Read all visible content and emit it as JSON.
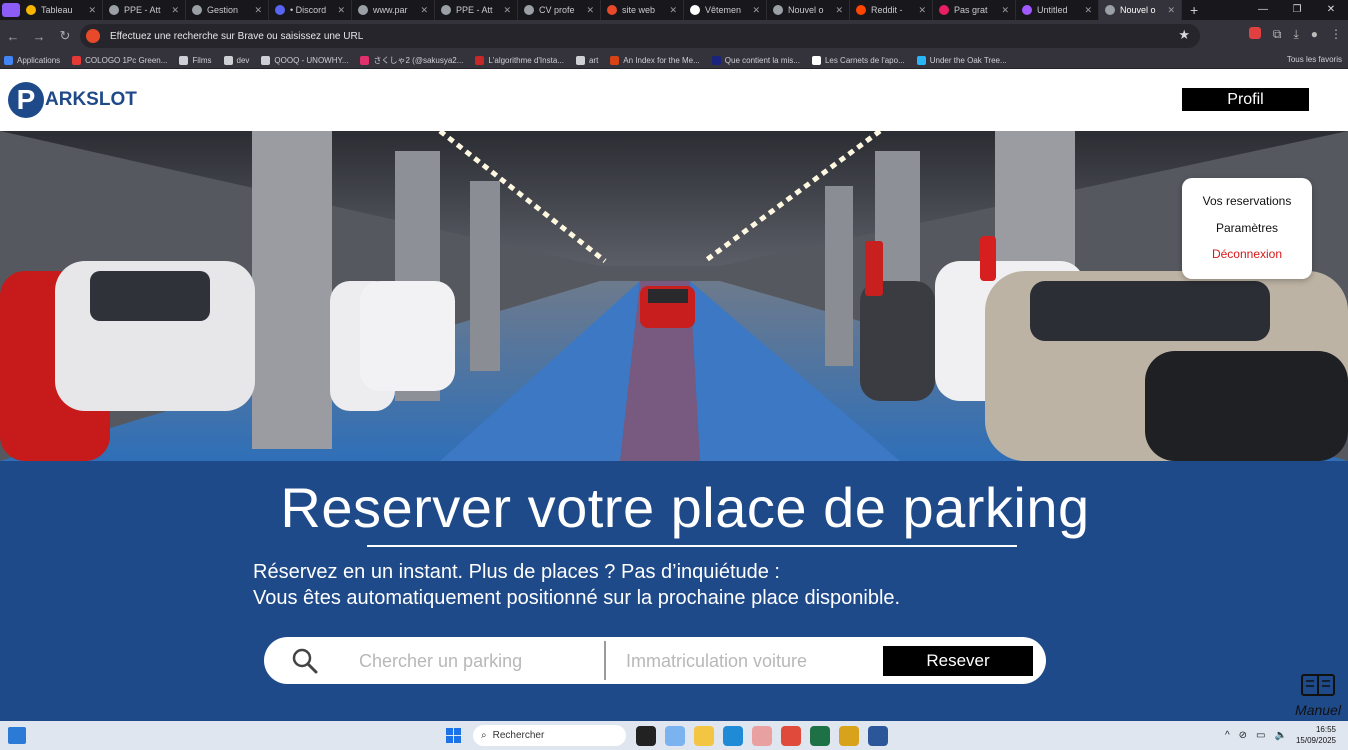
{
  "browser": {
    "tabs": [
      {
        "title": "Tableau",
        "icon": "miro-icon",
        "color": "#f7b500"
      },
      {
        "title": "PPE - Att",
        "icon": "globe-icon",
        "color": "#9aa0a6"
      },
      {
        "title": "Gestion",
        "icon": "gear-icon",
        "color": "#9aa0a6"
      },
      {
        "title": "• Discord",
        "icon": "discord-icon",
        "color": "#5865f2"
      },
      {
        "title": "www.par",
        "icon": "globe-icon",
        "color": "#9aa0a6"
      },
      {
        "title": "PPE - Att",
        "icon": "globe-icon",
        "color": "#9aa0a6"
      },
      {
        "title": "CV profe",
        "icon": "file-icon",
        "color": "#9aa0a6"
      },
      {
        "title": "site web",
        "icon": "brave-icon",
        "color": "#e8492a"
      },
      {
        "title": "Vêtemen",
        "icon": "b-icon",
        "color": "#ffffff"
      },
      {
        "title": "Nouvel o",
        "icon": "globe-icon",
        "color": "#9aa0a6"
      },
      {
        "title": "Reddit -",
        "icon": "reddit-icon",
        "color": "#ff4500"
      },
      {
        "title": "Pas grat",
        "icon": "shop-icon",
        "color": "#e91e63"
      },
      {
        "title": "Untitled",
        "icon": "figma-icon",
        "color": "#a259ff"
      },
      {
        "title": "Nouvel o",
        "icon": "globe-icon",
        "color": "#9aa0a6",
        "active": true
      }
    ],
    "new_tab": "+",
    "address_placeholder": "Effectuez une recherche sur Brave ou saisissez une URL",
    "bookmarks": [
      {
        "label": "Applications",
        "color": "#4285f4"
      },
      {
        "label": "COLOGO 1Pc Green...",
        "color": "#e53935"
      },
      {
        "label": "Films",
        "color": "#cfcfd6"
      },
      {
        "label": "dev",
        "color": "#cfcfd6"
      },
      {
        "label": "QOOQ - UNOWHY...",
        "color": "#cfcfd6"
      },
      {
        "label": "さくしゃ2 (@sakusya2...",
        "color": "#e1306c"
      },
      {
        "label": "L'algorithme d'Insta...",
        "color": "#c62828"
      },
      {
        "label": "art",
        "color": "#cfcfd6"
      },
      {
        "label": "An Index for the Me...",
        "color": "#d84315"
      },
      {
        "label": "Que contient la mis...",
        "color": "#1a237e"
      },
      {
        "label": "Les Carnets de l'apo...",
        "color": "#ffffff"
      },
      {
        "label": "Under the Oak Tree...",
        "color": "#29b6f6"
      }
    ],
    "bookmarks_right": "Tous les favoris"
  },
  "site": {
    "logo_letter": "P",
    "logo_text": "ARKSLOT",
    "profil_label": "Profil",
    "menu": {
      "reservations": "Vos reservations",
      "settings": "Paramètres",
      "logout": "Déconnexion"
    },
    "headline": "Reserver votre place de parking",
    "subtitle_line1": "Réservez en un instant. Plus de places ? Pas d’inquiétude :",
    "subtitle_line2": "Vous êtes automatiquement positionné sur la prochaine place disponible.",
    "search_parking_placeholder": "Chercher un parking",
    "plate_placeholder": "Immatriculation voiture",
    "reserve_button": "Resever",
    "manual_label": "Manuel",
    "brand_color": "#1f4a8a"
  },
  "taskbar": {
    "search_label": "Rechercher",
    "time": "16:55",
    "date": "15/09/2025"
  }
}
